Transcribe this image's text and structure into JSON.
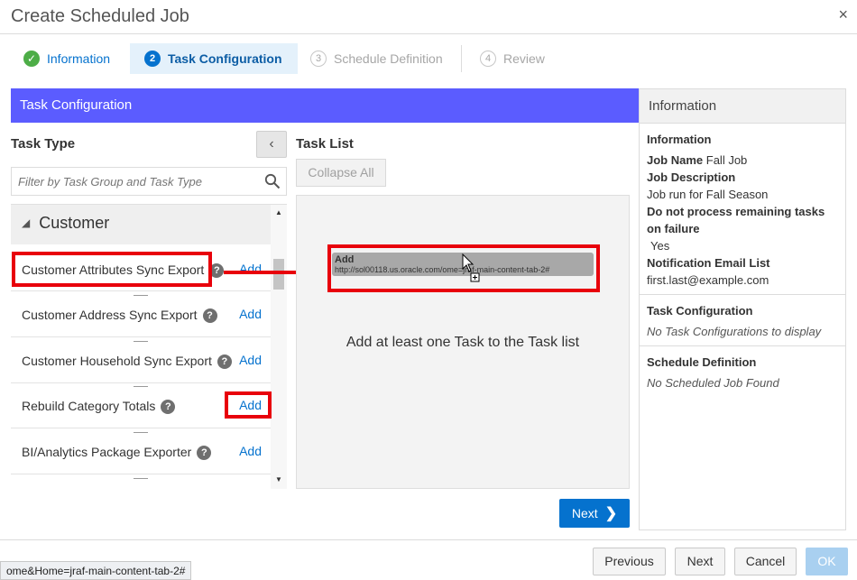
{
  "dialog": {
    "title": "Create Scheduled Job",
    "close_glyph": "×"
  },
  "train": {
    "steps": [
      {
        "number": "✓",
        "label": "Information",
        "state": "completed"
      },
      {
        "number": "2",
        "label": "Task Configuration",
        "state": "current"
      },
      {
        "number": "3",
        "label": "Schedule Definition",
        "state": "disabled"
      },
      {
        "number": "4",
        "label": "Review",
        "state": "disabled"
      }
    ]
  },
  "task_config": {
    "header": "Task Configuration",
    "task_type_label": "Task Type",
    "collapse_glyph": "‹",
    "filter_placeholder": "Filter by Task Group and Task Type",
    "group_name": "Customer",
    "tasks": [
      {
        "name": "Customer Attributes Sync Export",
        "action": "Add"
      },
      {
        "name": "Customer Address Sync Export",
        "action": "Add"
      },
      {
        "name": "Customer Household Sync Export",
        "action": "Add"
      },
      {
        "name": "Rebuild Category Totals",
        "action": "Add"
      },
      {
        "name": "BI/Analytics Package Exporter",
        "action": "Add"
      }
    ],
    "help_glyph": "?",
    "task_list_label": "Task List",
    "collapse_all": "Collapse All",
    "empty_message": "Add at least one Task to the Task list",
    "drag_ghost": {
      "title": "Add",
      "url": "http://sol00118.us.oracle.com/ome=jraf-main-content-tab-2#"
    },
    "next_button": "Next"
  },
  "info_panel": {
    "title": "Information",
    "info_section": {
      "heading": "Information",
      "job_name_label": "Job Name",
      "job_name_value": "Fall Job",
      "job_desc_label": "Job Description",
      "job_desc_value": "Job run for Fall Season",
      "dnp_label": "Do not process remaining tasks on failure",
      "dnp_value": "Yes",
      "email_label": "Notification Email List",
      "email_value": "first.last@example.com"
    },
    "task_config_section": {
      "heading": "Task Configuration",
      "empty": "No Task Configurations to display"
    },
    "schedule_section": {
      "heading": "Schedule Definition",
      "empty": "No Scheduled Job Found"
    }
  },
  "footer": {
    "previous": "Previous",
    "next": "Next",
    "cancel": "Cancel",
    "ok": "OK"
  },
  "status_bar": {
    "url": "ome&Home=jraf-main-content-tab-2#"
  },
  "colors": {
    "accent": "#5b5cff",
    "primary": "#0572ce",
    "annotation_red": "#e8000b",
    "completed_green": "#4dad47"
  }
}
